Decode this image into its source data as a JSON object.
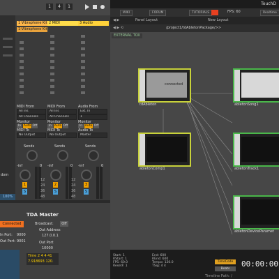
{
  "ableton": {
    "transport": {
      "bar_pos": "1",
      "beat_pos": "4",
      "sixteenth_pos": "1"
    },
    "tracks": [
      {
        "name": "1 Vibraphone Kit",
        "color": "#ffb84a",
        "clip": "1-Vibraphone Kit"
      },
      {
        "name": "2 MIDI",
        "color": "#ffdc4a",
        "clip": ""
      },
      {
        "name": "3 Audio",
        "color": "#ffd23a",
        "clip": ""
      }
    ],
    "io": [
      {
        "from_label": "MIDI From",
        "from_value": "All Ins",
        "channel": "All Channels",
        "monitor_label": "Monitor",
        "monitor_in": "In",
        "monitor_auto": "Auto",
        "monitor_off": "Off",
        "to_label": "MIDI To",
        "to_value": "No Output"
      },
      {
        "from_label": "MIDI From",
        "from_value": "All Ins",
        "channel": "All Channels",
        "monitor_label": "Monitor",
        "monitor_in": "In",
        "monitor_auto": "Auto",
        "monitor_off": "Off",
        "to_label": "MIDI To",
        "to_value": "No Output"
      },
      {
        "from_label": "Audio From",
        "from_value": "Ext. In",
        "channel": "1",
        "monitor_label": "Monitor",
        "monitor_in": "In",
        "monitor_auto": "Auto",
        "monitor_off": "Off",
        "to_label": "Audio To",
        "to_value": "Master"
      }
    ],
    "sends_label": "Sends",
    "mixer": [
      {
        "pan": "-inf",
        "volume": "0",
        "number": "1"
      },
      {
        "pan": "-inf",
        "volume": "0",
        "number": "2"
      },
      {
        "pan": "-inf",
        "volume": "0",
        "number": "3"
      }
    ],
    "scale": [
      "12",
      "24",
      "36",
      "48",
      "60"
    ],
    "left_cut": [
      "dom",
      "100%"
    ],
    "solo_label": "S",
    "tda": {
      "title": "TDA Master",
      "connected": "Connected",
      "broadcast_label": "Broadcast:",
      "broadcast_value": "Off",
      "in_port_label": "In Port:",
      "in_port_value": "9000",
      "out_port_label": "Out Port:",
      "out_port_value": "9001",
      "out_address_label": "Out Address",
      "out_address_value": "127.0.0.1",
      "out_port2_label": "Out Port",
      "out_port2_value": "10000",
      "time_line1": "Time 2 4 4 41",
      "time_line2": "7.918693 120."
    }
  },
  "td": {
    "title": "TouchD",
    "links": [
      "WIKI",
      "FORUM",
      "TUTORIALS",
      "Realtime"
    ],
    "fps_label": "FPS: 60",
    "layout": [
      "Panel Layout",
      "New Layout"
    ],
    "path": "/project1/tdAbletonPackage/>>",
    "external_tox": "EXTERNAL TOX",
    "nodes": [
      {
        "label": "tdAbleton",
        "content": "connected"
      },
      {
        "label": "abletonSong1",
        "content": ""
      },
      {
        "label": "abletonComp1",
        "content": ""
      },
      {
        "label": "abletonTrack1",
        "content": ""
      },
      {
        "label": "abletonDeviceParamet",
        "content": ""
      }
    ],
    "info": [
      {
        "label": "Start:",
        "value": "1"
      },
      {
        "label": "RStart:",
        "value": "1"
      },
      {
        "label": "FPS:",
        "value": "60.0"
      },
      {
        "label": "ResetF:",
        "value": "1"
      },
      {
        "label": "End:",
        "value": "600"
      },
      {
        "label": "REnd:",
        "value": "600"
      },
      {
        "label": "Tempo:",
        "value": "120.0"
      },
      {
        "label": "TSig:",
        "value": "4 4"
      }
    ],
    "timecode_btn": "TimeCode",
    "beats_btn": "Beats",
    "timecode": "00:00:00",
    "status": "Timeline Path: /"
  }
}
